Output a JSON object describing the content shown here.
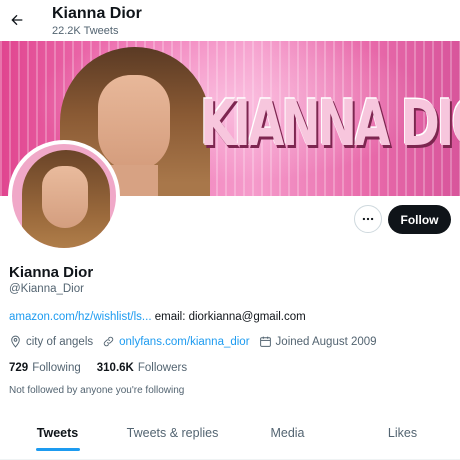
{
  "header": {
    "title": "Kianna Dior",
    "tweet_count": "22.2K Tweets",
    "back_icon": "arrow-left-icon"
  },
  "banner": {
    "brand_text": "KIANNA DIOR"
  },
  "actions": {
    "more_icon": "more-horizontal-icon",
    "follow_label": "Follow"
  },
  "profile": {
    "name": "Kianna Dior",
    "handle": "@Kianna_Dior",
    "bio_link": "amazon.com/hz/wishlist/ls...",
    "bio_email": "email: diorkianna@gmail.com",
    "location": "city of angels",
    "website": "onlyfans.com/kianna_dior",
    "joined": "Joined August 2009",
    "following_count": "729",
    "following_label": "Following",
    "followers_count": "310.6K",
    "followers_label": "Followers",
    "not_followed_text": "Not followed by anyone you're following"
  },
  "tabs": [
    {
      "label": "Tweets",
      "active": true
    },
    {
      "label": "Tweets & replies",
      "active": false
    },
    {
      "label": "Media",
      "active": false
    },
    {
      "label": "Likes",
      "active": false
    }
  ],
  "colors": {
    "accent": "#1d9bf0",
    "text": "#0f1419",
    "muted": "#536471",
    "follow_bg": "#0f1419"
  }
}
